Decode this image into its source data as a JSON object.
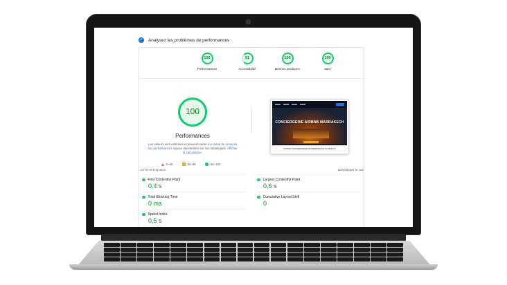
{
  "checkbox": {
    "label": "Analysez les problèmes de performances"
  },
  "categories": [
    {
      "label": "Performances",
      "score": "100"
    },
    {
      "label": "Accessibilité",
      "score": "91"
    },
    {
      "label": "Bonnes pratiques",
      "score": "100"
    },
    {
      "label": "SEO",
      "score": "100"
    }
  ],
  "summary": {
    "score": "100",
    "title": "Performances",
    "desc_1": "Les valeurs sont estimées et peuvent varier. Le ",
    "desc_link_1": "calcul du score lié aux performances",
    "desc_2": " repose directement sur ces statistiques. ",
    "desc_link_2": "Afficher la calculatrice."
  },
  "legend": [
    {
      "label": "0–49",
      "color": "#ff4e42"
    },
    {
      "label": "50–89",
      "color": "#ffa400"
    },
    {
      "label": "90–100",
      "color": "#0cce6b"
    }
  ],
  "preview": {
    "hero_title": "CONCIERGERIE AIRBNB MARRAKECH",
    "footer_text": "VOTRE CONCIERGERIE DE RÉFÉRENCE AU MAROC"
  },
  "stats": {
    "title": "STATISTIQUES",
    "expand_label": "Développer la vue",
    "metrics": [
      {
        "name": "First Contentful Paint",
        "value": "0,4 s"
      },
      {
        "name": "Largest Contentful Paint",
        "value": "0,6 s"
      },
      {
        "name": "Total Blocking Time",
        "value": "0 ms"
      },
      {
        "name": "Cumulative Layout Shift",
        "value": "0"
      },
      {
        "name": "Speed Index",
        "value": "0,5 s"
      }
    ]
  },
  "colors": {
    "good": "#0cce6b",
    "link": "#1a73e8"
  }
}
